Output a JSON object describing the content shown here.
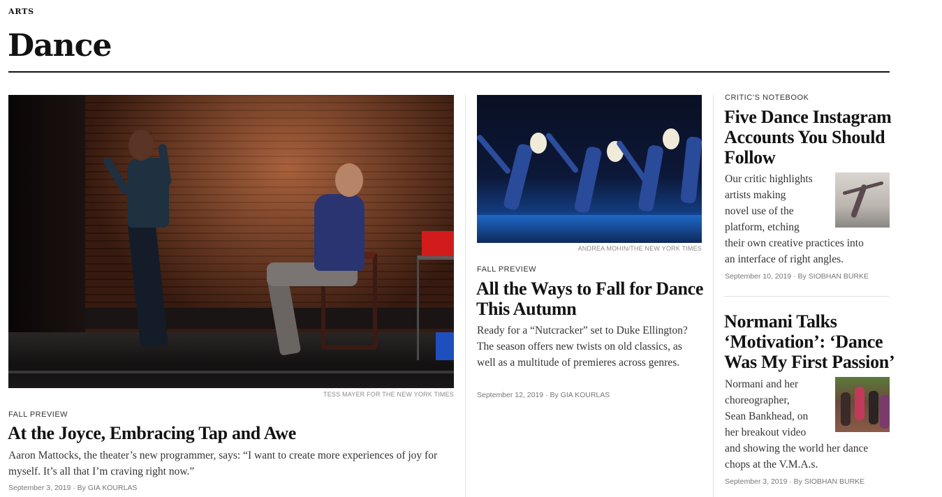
{
  "section": {
    "kicker": "ARTS",
    "title": "Dance"
  },
  "articles": {
    "lead": {
      "credit": "TESS MAYER FOR THE NEW YORK TIMES",
      "kicker": "FALL PREVIEW",
      "headline": "At the Joyce, Embracing Tap and Awe",
      "summary": "Aaron Mattocks, the theater’s new programmer, says: “I want to create more experiences of joy for myself. It’s all that I’m craving right now.”",
      "byline": "September 3, 2019 · By GIA KOURLAS"
    },
    "middle": {
      "credit": "ANDREA MOHIN/THE NEW YORK TIMES",
      "kicker": "FALL PREVIEW",
      "headline": "All the Ways to Fall for Dance This Autumn",
      "summary": "Ready for a “Nutcracker” set to Duke Ellington? The season offers new twists on old classics, as well as a multitude of premieres across genres.",
      "byline": "September 12, 2019 · By GIA KOURLAS"
    },
    "right_top": {
      "kicker": "CRITIC’S NOTEBOOK",
      "headline": "Five Dance Instagram Accounts You Should Follow",
      "summary_lines": [
        "Our critic highlights",
        "artists making",
        "novel use of the",
        "platform, etching",
        "their own creative practices into",
        "an interface of right angles."
      ],
      "byline": "September 10, 2019 · By SIOBHAN BURKE"
    },
    "right_bottom": {
      "headline": "Normani Talks ‘Motivation’: ‘Dance Was My First Passion’",
      "summary_lines": [
        "Normani and her",
        "choreographer,",
        "Sean Bankhead, on",
        "her breakout video",
        "and showing the world her dance",
        "chops at the V.M.A.s."
      ],
      "byline": "September 3, 2019 · By SIOBHAN BURKE"
    }
  }
}
